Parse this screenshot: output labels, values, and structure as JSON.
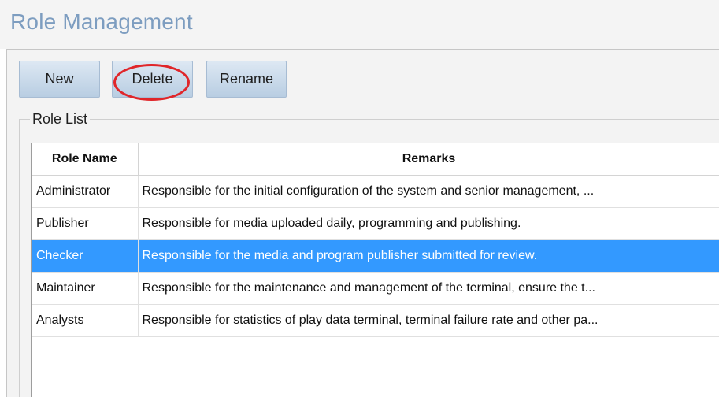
{
  "header": {
    "title": "Role Management"
  },
  "toolbar": {
    "new_label": "New",
    "delete_label": "Delete",
    "rename_label": "Rename"
  },
  "role_list": {
    "label": "Role List",
    "columns": [
      "Role Name",
      "Remarks"
    ],
    "selected_row": 2,
    "rows": [
      {
        "name": "Administrator",
        "remarks": "Responsible for the initial configuration of the system and senior management, ..."
      },
      {
        "name": "Publisher",
        "remarks": "Responsible for media uploaded daily, programming and publishing."
      },
      {
        "name": "Checker",
        "remarks": "Responsible for the media and program publisher submitted for review."
      },
      {
        "name": "Maintainer",
        "remarks": "Responsible for the maintenance and management of the terminal, ensure the t..."
      },
      {
        "name": "Analysts",
        "remarks": "Responsible for statistics of play data terminal, terminal failure rate and other pa..."
      }
    ]
  },
  "colors": {
    "title": "#7d9dc0",
    "selection": "#3399ff",
    "annotation_circle": "#e0262a"
  }
}
